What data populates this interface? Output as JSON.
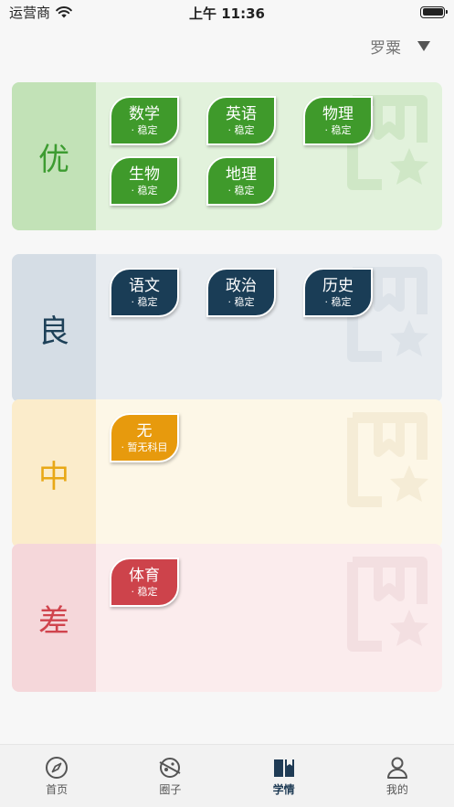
{
  "status_bar": {
    "carrier": "运营商",
    "time": "上午 11:36"
  },
  "user_selector": {
    "name": "罗粟"
  },
  "grades": [
    {
      "label": "优",
      "colors": {
        "label_bg": "#c2e2b7",
        "body_bg": "#e2f2dc",
        "label_text": "#3d9c31",
        "chip": "#3f9a2b",
        "watermark": "#cfe7c6"
      },
      "subjects": [
        {
          "name": "数学",
          "status": "· 稳定"
        },
        {
          "name": "英语",
          "status": "· 稳定"
        },
        {
          "name": "物理",
          "status": "· 稳定"
        },
        {
          "name": "生物",
          "status": "· 稳定"
        },
        {
          "name": "地理",
          "status": "· 稳定"
        }
      ]
    },
    {
      "label": "良",
      "colors": {
        "label_bg": "#d5dde5",
        "body_bg": "#e8ecf0",
        "label_text": "#1d4058",
        "chip": "#1a3d56",
        "watermark": "#dce2e8"
      },
      "subjects": [
        {
          "name": "语文",
          "status": "· 稳定"
        },
        {
          "name": "政治",
          "status": "· 稳定"
        },
        {
          "name": "历史",
          "status": "· 稳定"
        }
      ]
    },
    {
      "label": "中",
      "colors": {
        "label_bg": "#fbeccb",
        "body_bg": "#fdf7e7",
        "label_text": "#e8a816",
        "chip": "#e79a0d",
        "watermark": "#f5ecd6"
      },
      "subjects": [
        {
          "name": "无",
          "status": "· 暂无科目"
        }
      ]
    },
    {
      "label": "差",
      "colors": {
        "label_bg": "#f5d7da",
        "body_bg": "#fbeced",
        "label_text": "#d0444d",
        "chip": "#cd434b",
        "watermark": "#f3dfe1"
      },
      "subjects": [
        {
          "name": "体育",
          "status": "· 稳定"
        }
      ]
    }
  ],
  "tabs": [
    {
      "label": "首页",
      "icon": "compass-icon",
      "active": false
    },
    {
      "label": "圈子",
      "icon": "planet-icon",
      "active": false
    },
    {
      "label": "学情",
      "icon": "book-icon",
      "active": true
    },
    {
      "label": "我的",
      "icon": "person-icon",
      "active": false
    }
  ]
}
